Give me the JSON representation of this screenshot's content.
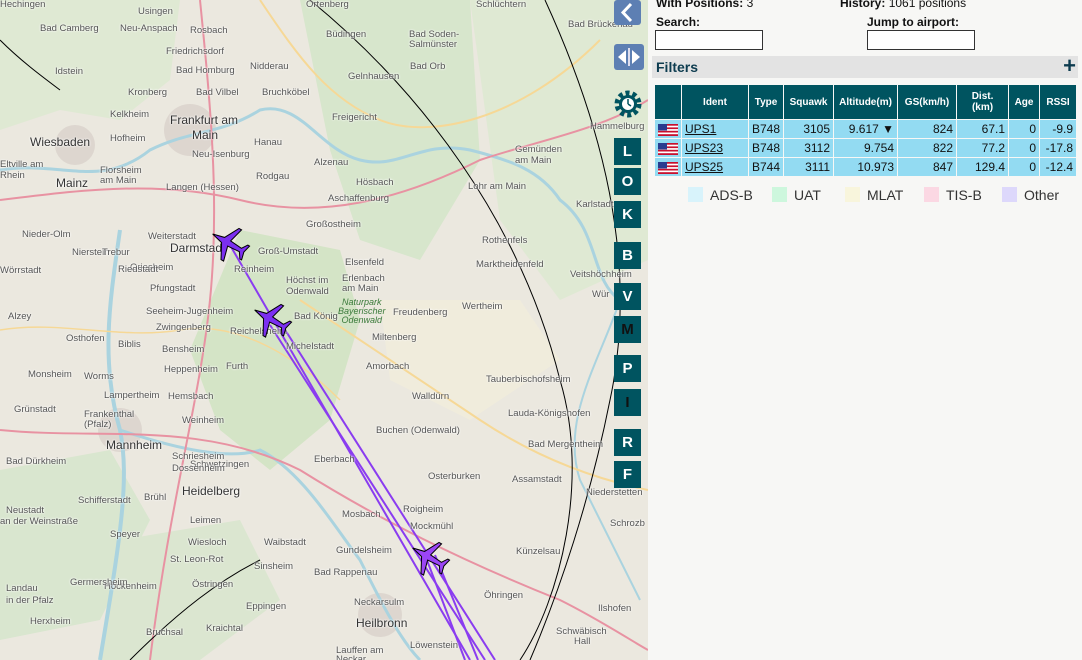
{
  "map": {
    "towns": [
      {
        "name": "Usingen",
        "big": false
      },
      {
        "name": "Bad Camberg",
        "big": false
      },
      {
        "name": "Neu-Anspach",
        "big": false
      },
      {
        "name": "Rosbach",
        "big": false
      },
      {
        "name": "Friedrichsdorf",
        "big": false
      },
      {
        "name": "Idstein",
        "big": false
      },
      {
        "name": "Bad Homburg",
        "big": false
      },
      {
        "name": "Nidderau",
        "big": false
      },
      {
        "name": "Kronberg",
        "big": false
      },
      {
        "name": "Bad Vilbel",
        "big": false
      },
      {
        "name": "Bruchköbel",
        "big": false
      },
      {
        "name": "Kelkheim",
        "big": false
      },
      {
        "name": "Wiesbaden",
        "big": true
      },
      {
        "name": "Hofheim",
        "big": false
      },
      {
        "name": "Frankfurt am",
        "big": true
      },
      {
        "name": "Main",
        "big": true
      },
      {
        "name": "Hanau",
        "big": false
      },
      {
        "name": "Neu-Isenburg",
        "big": false
      },
      {
        "name": "Mainz",
        "big": true
      },
      {
        "name": "Langen (Hessen)",
        "big": false
      },
      {
        "name": "Rodgau",
        "big": false
      },
      {
        "name": "Darmstadt",
        "big": true
      },
      {
        "name": "Groß-Umstadt",
        "big": false
      },
      {
        "name": "Reinheim",
        "big": false
      },
      {
        "name": "Aschaffenburg",
        "big": false
      },
      {
        "name": "Großostheim",
        "big": false
      },
      {
        "name": "Hösbach",
        "big": false
      },
      {
        "name": "Alzenau",
        "big": false
      },
      {
        "name": "Gelnhausen",
        "big": false
      },
      {
        "name": "Büdingen",
        "big": false
      },
      {
        "name": "Bad Soden-",
        "big": false
      },
      {
        "name": "Salmünster",
        "big": false
      },
      {
        "name": "Bad Orb",
        "big": false
      },
      {
        "name": "Lohr am Main",
        "big": false
      },
      {
        "name": "Gemünden",
        "big": false
      },
      {
        "name": "am Main",
        "big": false
      },
      {
        "name": "Hammelburg",
        "big": false
      },
      {
        "name": "Karlstadt",
        "big": false
      },
      {
        "name": "Marktheidenfeld",
        "big": false
      },
      {
        "name": "Veitshöchheim",
        "big": false
      },
      {
        "name": "Rothenfels",
        "big": false
      },
      {
        "name": "Wertheim",
        "big": false
      },
      {
        "name": "Freudenberg",
        "big": false
      },
      {
        "name": "Miltenberg",
        "big": false
      },
      {
        "name": "Elsenfeld",
        "big": false
      },
      {
        "name": "Erlenbach",
        "big": false
      },
      {
        "name": "am Main",
        "big": false
      },
      {
        "name": "Höchst im",
        "big": false
      },
      {
        "name": "Odenwald",
        "big": false
      },
      {
        "name": "Bad König",
        "big": false
      },
      {
        "name": "Michelstadt",
        "big": false
      },
      {
        "name": "Reichelsheim",
        "big": false
      },
      {
        "name": "Amorbach",
        "big": false
      },
      {
        "name": "Tauberbischofsheim",
        "big": false
      },
      {
        "name": "Walldürn",
        "big": false
      },
      {
        "name": "Lauda-Königshofen",
        "big": false
      },
      {
        "name": "Buchen (Odenwald)",
        "big": false
      },
      {
        "name": "Bad Mergentheim",
        "big": false
      },
      {
        "name": "Osterburken",
        "big": false
      },
      {
        "name": "Assamstadt",
        "big": false
      },
      {
        "name": "Niederstetten",
        "big": false
      },
      {
        "name": "Eberbach",
        "big": false
      },
      {
        "name": "Mosbach",
        "big": false
      },
      {
        "name": "Roigheim",
        "big": false
      },
      {
        "name": "Mockmühl",
        "big": false
      },
      {
        "name": "Gundelsheim",
        "big": false
      },
      {
        "name": "Neckarsulm",
        "big": false
      },
      {
        "name": "Künzelsau",
        "big": false
      },
      {
        "name": "Öhringen",
        "big": false
      },
      {
        "name": "Ilshofen",
        "big": false
      },
      {
        "name": "Schwäbisch",
        "big": false
      },
      {
        "name": "Hall",
        "big": false
      },
      {
        "name": "Heilbronn",
        "big": true
      },
      {
        "name": "Löwenstein",
        "big": false
      },
      {
        "name": "Lauffen am",
        "big": false
      },
      {
        "name": "Neckar",
        "big": false
      },
      {
        "name": "Bad Rappenau",
        "big": false
      },
      {
        "name": "Sinsheim",
        "big": false
      },
      {
        "name": "Waibstadt",
        "big": false
      },
      {
        "name": "Wiesloch",
        "big": false
      },
      {
        "name": "St. Leon-Rot",
        "big": false
      },
      {
        "name": "Östringen",
        "big": false
      },
      {
        "name": "Kraichtal",
        "big": false
      },
      {
        "name": "Bruchsal",
        "big": false
      },
      {
        "name": "Eppingen",
        "big": false
      },
      {
        "name": "Heidelberg",
        "big": true
      },
      {
        "name": "Mannheim",
        "big": true
      },
      {
        "name": "Schwetzingen",
        "big": false
      },
      {
        "name": "Leimen",
        "big": false
      },
      {
        "name": "Speyer",
        "big": false
      },
      {
        "name": "Hockenheim",
        "big": false
      },
      {
        "name": "Germersheim",
        "big": false
      },
      {
        "name": "Weinheim",
        "big": false
      },
      {
        "name": "Schriesheim",
        "big": false
      },
      {
        "name": "Dossenheim",
        "big": false
      },
      {
        "name": "Hemsbach",
        "big": false
      },
      {
        "name": "Lampertheim",
        "big": false
      },
      {
        "name": "Heppenheim",
        "big": false
      },
      {
        "name": "Bensheim",
        "big": false
      },
      {
        "name": "Zwingenberg",
        "big": false
      },
      {
        "name": "Seeheim-Jugenheim",
        "big": false
      },
      {
        "name": "Pfungstadt",
        "big": false
      },
      {
        "name": "Griesheim",
        "big": false
      },
      {
        "name": "Riedstadt",
        "big": false
      },
      {
        "name": "Weiterstadt",
        "big": false
      },
      {
        "name": "Nierstein",
        "big": false
      },
      {
        "name": "Trebur",
        "big": false
      },
      {
        "name": "Nieder-Olm",
        "big": false
      },
      {
        "name": "Wörrstadt",
        "big": false
      },
      {
        "name": "Alzey",
        "big": false
      },
      {
        "name": "Osthofen",
        "big": false
      },
      {
        "name": "Worms",
        "big": false
      },
      {
        "name": "Biblis",
        "big": false
      },
      {
        "name": "Monsheim",
        "big": false
      },
      {
        "name": "Grünstadt",
        "big": false
      },
      {
        "name": "Frankenthal",
        "big": false
      },
      {
        "name": "(Pfalz)",
        "big": false
      },
      {
        "name": "Bad Dürkheim",
        "big": false
      },
      {
        "name": "Schifferstadt",
        "big": false
      },
      {
        "name": "Neustadt",
        "big": false
      },
      {
        "name": "an der Weinstraße",
        "big": false
      },
      {
        "name": "Landau",
        "big": false
      },
      {
        "name": "in der Pfalz",
        "big": false
      },
      {
        "name": "Herxheim",
        "big": false
      },
      {
        "name": "Brühl",
        "big": false
      },
      {
        "name": "Furth",
        "big": false
      },
      {
        "name": "Florsheim",
        "big": false
      },
      {
        "name": "am Main",
        "big": false
      },
      {
        "name": "Eltville am",
        "big": false
      },
      {
        "name": "Rhein",
        "big": false
      },
      {
        "name": "Ortenberg",
        "big": false
      },
      {
        "name": "Schlüchtern",
        "big": false
      },
      {
        "name": "Bad Brückenau",
        "big": false
      },
      {
        "name": "Freigericht",
        "big": false
      },
      {
        "name": "Schrozb",
        "big": false
      },
      {
        "name": "Wür",
        "big": false
      },
      {
        "name": "Hechingen",
        "big": false
      }
    ],
    "park_label": "Naturpark\nBayerischer\nOdenwald",
    "buttons": [
      "L",
      "O",
      "K",
      "B",
      "V",
      "M",
      "P",
      "I",
      "R",
      "F"
    ]
  },
  "stats": {
    "positions_label": "With Positions:",
    "positions_value": "3",
    "history_label": "History:",
    "history_value": "1061 positions"
  },
  "search": {
    "label": "Search:",
    "value": ""
  },
  "jump": {
    "label": "Jump to airport:",
    "value": ""
  },
  "filters": {
    "title": "Filters",
    "plus": "+"
  },
  "table": {
    "headers": [
      "",
      "Ident",
      "Type",
      "Squawk",
      "Altitude(m)",
      "GS(km/h)",
      "Dist. (km)",
      "Age",
      "RSSI"
    ],
    "rows": [
      {
        "ident": "UPS1",
        "type": "B748",
        "squawk": "3105",
        "altitude": "9.617 ▼",
        "gs": "824",
        "dist": "67.1",
        "age": "0",
        "rssi": "-9.9"
      },
      {
        "ident": "UPS23",
        "type": "B748",
        "squawk": "3112",
        "altitude": "9.754",
        "gs": "822",
        "dist": "77.2",
        "age": "0",
        "rssi": "-17.8"
      },
      {
        "ident": "UPS25",
        "type": "B744",
        "squawk": "3111",
        "altitude": "10.973",
        "gs": "847",
        "dist": "129.4",
        "age": "0",
        "rssi": "-12.4"
      }
    ]
  },
  "legend": [
    {
      "label": "ADS-B",
      "color": "#d8f3fb"
    },
    {
      "label": "UAT",
      "color": "#cdf7dd"
    },
    {
      "label": "MLAT",
      "color": "#f8f5dc"
    },
    {
      "label": "TIS-B",
      "color": "#fbd8e3"
    },
    {
      "label": "Other",
      "color": "#ddd8fb"
    }
  ],
  "colors": {
    "accent": "#005460",
    "row": "#93dbf2",
    "track": "#8a3cf0",
    "plane": "#7b2ff0"
  }
}
